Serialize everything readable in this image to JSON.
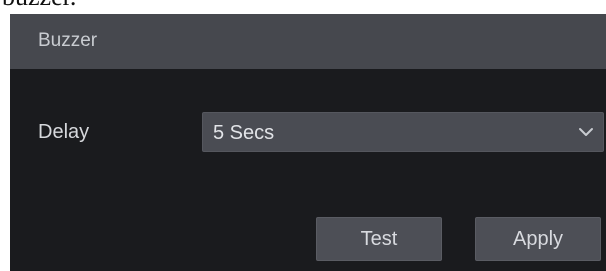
{
  "caption": {
    "text": "buzzer."
  },
  "panel": {
    "title": "Buzzer"
  },
  "delay": {
    "label": "Delay",
    "selected_value": "5 Secs",
    "icon": "chevron-down-icon"
  },
  "buttons": {
    "test_label": "Test",
    "apply_label": "Apply"
  },
  "colors": {
    "panel_background": "#1a1b1e",
    "header_background": "#46484e",
    "control_background": "#4a4c53",
    "text": "#d6d8dc"
  }
}
